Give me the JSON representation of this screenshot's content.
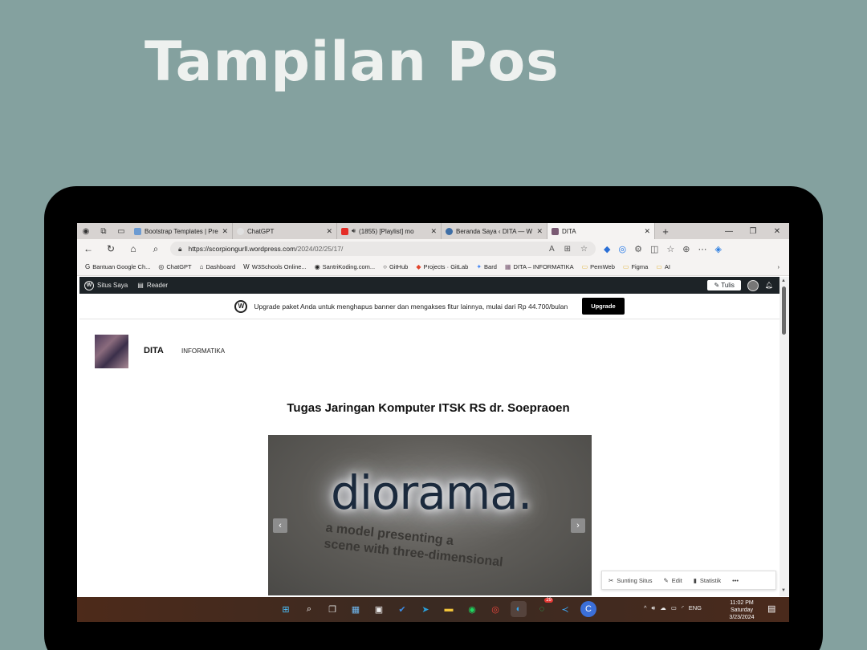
{
  "slide": {
    "title": "Tampilan Pos"
  },
  "browser": {
    "tabs": [
      {
        "label": "Bootstrap Templates | Pre",
        "color": "#6c9bd2"
      },
      {
        "label": "ChatGPT",
        "color": "#10a37f"
      },
      {
        "label": "(1855) [Playlist] mo",
        "color": "#e52d27"
      },
      {
        "label": "Beranda Saya ‹ DITA — W",
        "color": "#3e6ea6"
      },
      {
        "label": "DITA",
        "color": "#7a5a73"
      }
    ],
    "url_host": "https://scorpiongurll.wordpress.com",
    "url_path": "/2024/02/25/17/",
    "bookmarks": [
      {
        "icon": "G",
        "label": "Bantuan Google Ch..."
      },
      {
        "icon": "◎",
        "label": "ChatGPT"
      },
      {
        "icon": "⌂",
        "label": "Dashboard"
      },
      {
        "icon": "W",
        "label": "W3Schools Online..."
      },
      {
        "icon": "◉",
        "label": "SantriKoding.com..."
      },
      {
        "icon": "○",
        "label": "GitHub"
      },
      {
        "icon": "◆",
        "label": "Projects · GitLab"
      },
      {
        "icon": "✦",
        "label": "Bard"
      },
      {
        "icon": "▦",
        "label": "DITA – INFORMATIKA"
      },
      {
        "icon": "▭",
        "label": "PemWeb"
      },
      {
        "icon": "▭",
        "label": "Figma"
      },
      {
        "icon": "▭",
        "label": "AI"
      }
    ]
  },
  "wp": {
    "site_label": "Situs Saya",
    "reader_label": "Reader",
    "write_label": "Tulis",
    "banner_text": "Upgrade paket Anda untuk menghapus banner dan mengakses fitur lainnya, mulai dari Rp 44.700/bulan",
    "upgrade_label": "Upgrade"
  },
  "site": {
    "title": "DITA",
    "menu_item": "INFORMATIKA"
  },
  "post": {
    "title": "Tugas Jaringan Komputer ITSK RS dr. Soepraoen",
    "image_word": "diorama.",
    "image_tag_line1": "a model   presenting a",
    "image_tag_line2": "scene with three-dimensional"
  },
  "floatbar": {
    "edit_site": "Sunting Situs",
    "edit": "Edit",
    "stats": "Statistik"
  },
  "taskbar": {
    "lang": "ENG",
    "time": "11:02 PM",
    "day": "Saturday",
    "date": "3/23/2024",
    "badge": "29"
  }
}
